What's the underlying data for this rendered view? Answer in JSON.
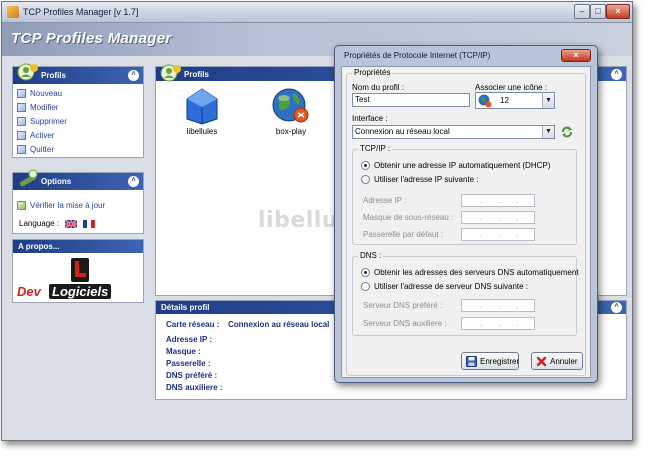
{
  "window": {
    "title": "TCP Profiles Manager [v 1.7]",
    "banner": "TCP Profiles Manager"
  },
  "sidebar": {
    "profils": {
      "header": "Profils",
      "items": [
        {
          "label": "Nouveau"
        },
        {
          "label": "Modifier"
        },
        {
          "label": "Supprimer"
        },
        {
          "label": "Activer"
        },
        {
          "label": "Quitter"
        }
      ]
    },
    "options": {
      "header": "Options",
      "update_link": "Vérifier la mise à jour",
      "language_label": "Language :"
    },
    "about": {
      "header": "A propos...",
      "logo_text_dev": "Dev",
      "logo_text_logiciels": "Logiciels"
    }
  },
  "profiles_panel": {
    "header": "Profils",
    "items": [
      {
        "label": "libellules"
      },
      {
        "label": "box-play"
      }
    ]
  },
  "details": {
    "header": "Détails profil",
    "carte_label": "Carte réseau :",
    "carte_value": "Connexion au réseau local",
    "ip_label": "Adresse IP :",
    "masque_label": "Masque :",
    "passerelle_label": "Passerelle :",
    "dns_pref_label": "DNS préféré :",
    "dns_aux_label": "DNS auxiliere :"
  },
  "dialog": {
    "title": "Propriétés de Protocole Internet (TCP/IP)",
    "proprietes_group": "Propriétés",
    "nom_label": "Nom du profil :",
    "nom_value": "Test",
    "icone_label": "Associer une icône :",
    "icone_value": "12",
    "interface_label": "Interface :",
    "interface_value": "Connexion au réseau local",
    "tcpip_group": "TCP/IP :",
    "radio_dhcp": "Obtenir une adresse IP automatiquement (DHCP)",
    "radio_static": "Utiliser l'adresse IP suivante :",
    "ip_label": "Adresse IP :",
    "mask_label": "Masque de sous-réseau :",
    "gateway_label": "Passerelle par défaut :",
    "dns_group": "DNS :",
    "radio_dns_auto": "Obtenir les adresses des serveurs DNS automatiquement",
    "radio_dns_static": "Utiliser l'adresse de serveur DNS suivante :",
    "dns_pref_label": "Serveur DNS préféré :",
    "dns_aux_label": "Serveur DNS auxiliere :",
    "save_button": "Enregistrer",
    "cancel_button": "Annuler"
  },
  "watermark": "libellules.ch",
  "colors": {
    "accent": "#1f3d86",
    "link": "#2743a0",
    "detail_text": "#1b2f86"
  },
  "icons": [
    "profile-icon",
    "options-icon",
    "refresh-icon",
    "globe-icon",
    "flag-uk-icon",
    "flag-fr-icon"
  ]
}
